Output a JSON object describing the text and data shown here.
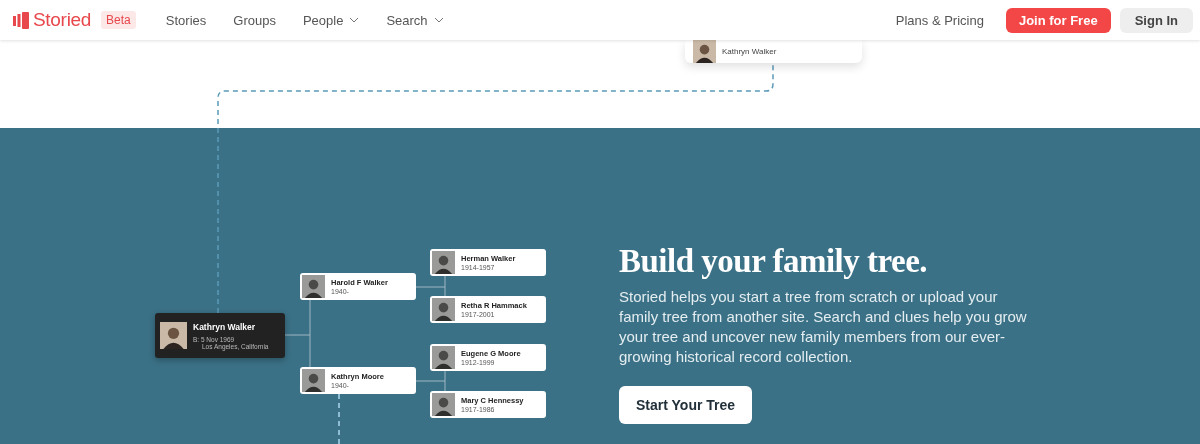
{
  "header": {
    "logo": "Storied",
    "badge": "Beta",
    "nav": [
      {
        "label": "Stories",
        "has_menu": false
      },
      {
        "label": "Groups",
        "has_menu": false
      },
      {
        "label": "People",
        "has_menu": true
      },
      {
        "label": "Search",
        "has_menu": true
      }
    ],
    "plans_link": "Plans & Pricing",
    "join_button": "Join for Free",
    "signin_button": "Sign In"
  },
  "tree": {
    "top_card": {
      "name": "Kathryn Walker"
    },
    "root": {
      "name": "Kathryn Walker",
      "birth": "B: 5 Nov 1969",
      "place": "Los Angeles, California"
    },
    "parents": [
      {
        "name": "Harold F Walker",
        "years": "1940-"
      },
      {
        "name": "Kathryn Moore",
        "years": "1940-"
      }
    ],
    "grandparents": [
      {
        "name": "Herman Walker",
        "years": "1914-1957"
      },
      {
        "name": "Retha R Hammack",
        "years": "1917-2001"
      },
      {
        "name": "Eugene G Moore",
        "years": "1912-1999"
      },
      {
        "name": "Mary C Hennessy",
        "years": "1917-1986"
      }
    ]
  },
  "hero": {
    "title": "Build your family tree.",
    "body": "Storied helps you start a tree from scratch or upload your family tree from another site. Search and clues help you grow your tree and uncover new family members from our ever-growing historical record collection.",
    "button": "Start Your Tree"
  }
}
